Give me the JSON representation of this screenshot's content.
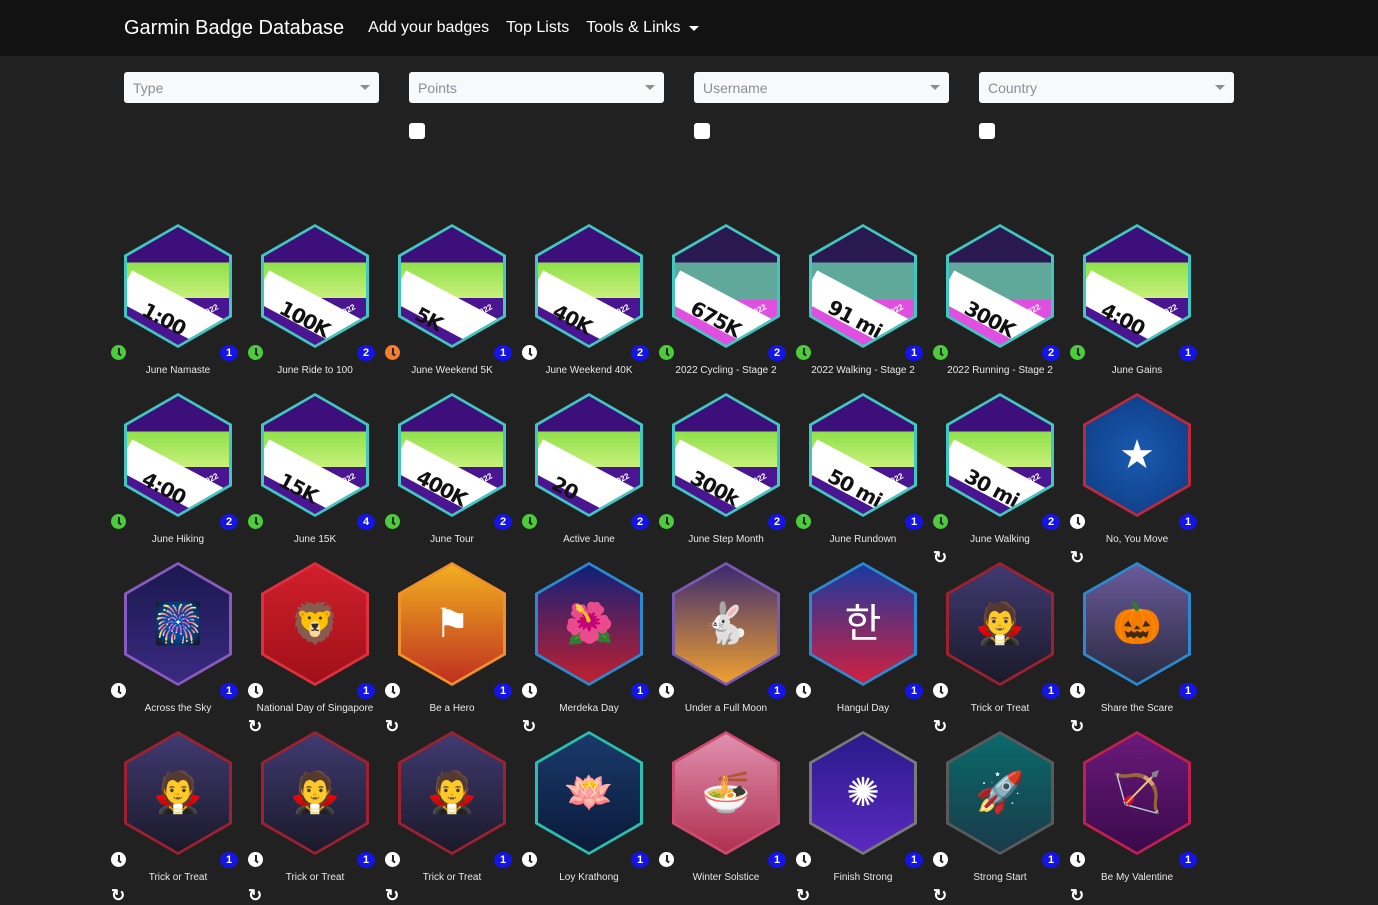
{
  "navbar": {
    "brand": "Garmin Badge Database",
    "links": [
      {
        "label": "Add your badges",
        "dropdown": false
      },
      {
        "label": "Top Lists",
        "dropdown": false
      },
      {
        "label": "Tools & Links",
        "dropdown": true
      }
    ]
  },
  "filters": [
    {
      "placeholder": "Type",
      "has_checkbox": false
    },
    {
      "placeholder": "Points",
      "has_checkbox": true,
      "checked": false
    },
    {
      "placeholder": "Username",
      "has_checkbox": true,
      "checked": false
    },
    {
      "placeholder": "Country",
      "has_checkbox": true,
      "checked": false
    }
  ],
  "colors": {
    "clock_green": "#4ccc3a",
    "clock_orange": "#f08030",
    "clock_white": "#ffffff",
    "count_badge": "#1414e6",
    "navbar_bg": "#121212",
    "page_bg": "#212121"
  },
  "badges": [
    {
      "name": "June Namaste",
      "label": "1:00",
      "year": "2022",
      "count": "1",
      "clock": "green",
      "repeat": false,
      "theme": "june"
    },
    {
      "name": "June Ride to 100",
      "label": "100K",
      "year": "2022",
      "count": "2",
      "clock": "green",
      "repeat": false,
      "theme": "june"
    },
    {
      "name": "June Weekend 5K",
      "label": "5K",
      "year": "2022",
      "count": "1",
      "clock": "orange",
      "repeat": false,
      "theme": "june"
    },
    {
      "name": "June Weekend 40K",
      "label": "40K",
      "year": "2022",
      "count": "2",
      "clock": "white",
      "repeat": false,
      "theme": "june"
    },
    {
      "name": "2022 Cycling - Stage 2",
      "label": "675K",
      "year": "2022",
      "count": "2",
      "clock": "green",
      "repeat": false,
      "theme": "stage"
    },
    {
      "name": "2022 Walking - Stage 2",
      "label": "91 mi",
      "year": "2022",
      "count": "1",
      "clock": "green",
      "repeat": false,
      "theme": "stage"
    },
    {
      "name": "2022 Running - Stage 2",
      "label": "300K",
      "year": "2022",
      "count": "2",
      "clock": "green",
      "repeat": false,
      "theme": "stage"
    },
    {
      "name": "June Gains",
      "label": "4:00",
      "year": "2022",
      "count": "1",
      "clock": "green",
      "repeat": false,
      "theme": "june"
    },
    {
      "name": "June Hiking",
      "label": "4:00",
      "year": "2022",
      "count": "2",
      "clock": "green",
      "repeat": false,
      "theme": "june"
    },
    {
      "name": "June 15K",
      "label": "15K",
      "year": "2022",
      "count": "4",
      "clock": "green",
      "repeat": false,
      "theme": "june"
    },
    {
      "name": "June Tour",
      "label": "400K",
      "year": "2022",
      "count": "2",
      "clock": "green",
      "repeat": false,
      "theme": "june"
    },
    {
      "name": "Active June",
      "label": "20",
      "year": "2022",
      "count": "2",
      "clock": "green",
      "repeat": false,
      "theme": "june"
    },
    {
      "name": "June Step Month",
      "label": "300k",
      "year": "2022",
      "count": "2",
      "clock": "green",
      "repeat": false,
      "theme": "june"
    },
    {
      "name": "June Rundown",
      "label": "50 mi",
      "year": "2022",
      "count": "1",
      "clock": "green",
      "repeat": false,
      "theme": "june"
    },
    {
      "name": "June Walking",
      "label": "30 mi",
      "year": "2022",
      "count": "2",
      "clock": "green",
      "repeat": true,
      "theme": "june"
    },
    {
      "name": "No, You Move",
      "label": "",
      "year": "",
      "count": "1",
      "clock": "white",
      "repeat": true,
      "theme": "shield"
    },
    {
      "name": "Across the Sky",
      "label": "",
      "year": "",
      "count": "1",
      "clock": "white",
      "repeat": false,
      "theme": "sky"
    },
    {
      "name": "National Day of Singapore",
      "label": "",
      "year": "",
      "count": "1",
      "clock": "white",
      "repeat": true,
      "theme": "singapore"
    },
    {
      "name": "Be a Hero",
      "label": "",
      "year": "",
      "count": "1",
      "clock": "white",
      "repeat": true,
      "theme": "hero"
    },
    {
      "name": "Merdeka Day",
      "label": "",
      "year": "",
      "count": "1",
      "clock": "white",
      "repeat": true,
      "theme": "merdeka"
    },
    {
      "name": "Under a Full Moon",
      "label": "",
      "year": "",
      "count": "1",
      "clock": "white",
      "repeat": false,
      "theme": "moon"
    },
    {
      "name": "Hangul Day",
      "label": "",
      "year": "",
      "count": "1",
      "clock": "white",
      "repeat": false,
      "theme": "hangul"
    },
    {
      "name": "Trick or Treat",
      "label": "",
      "year": "",
      "count": "1",
      "clock": "white",
      "repeat": true,
      "theme": "halloween"
    },
    {
      "name": "Share the Scare",
      "label": "",
      "year": "",
      "count": "1",
      "clock": "white",
      "repeat": true,
      "theme": "pumpkin"
    },
    {
      "name": "Trick or Treat",
      "label": "",
      "year": "",
      "count": "1",
      "clock": "white",
      "repeat": true,
      "theme": "halloween"
    },
    {
      "name": "Trick or Treat",
      "label": "",
      "year": "",
      "count": "1",
      "clock": "white",
      "repeat": true,
      "theme": "halloween"
    },
    {
      "name": "Trick or Treat",
      "label": "",
      "year": "",
      "count": "1",
      "clock": "white",
      "repeat": true,
      "theme": "halloween"
    },
    {
      "name": "Loy Krathong",
      "label": "",
      "year": "",
      "count": "1",
      "clock": "white",
      "repeat": false,
      "theme": "krathong"
    },
    {
      "name": "Winter Solstice",
      "label": "",
      "year": "",
      "count": "1",
      "clock": "white",
      "repeat": false,
      "theme": "solstice"
    },
    {
      "name": "Finish Strong",
      "label": "",
      "year": "",
      "count": "1",
      "clock": "white",
      "repeat": true,
      "theme": "fireworks"
    },
    {
      "name": "Strong Start",
      "label": "",
      "year": "",
      "count": "1",
      "clock": "white",
      "repeat": true,
      "theme": "rocket"
    },
    {
      "name": "Be My Valentine",
      "label": "",
      "year": "",
      "count": "1",
      "clock": "white",
      "repeat": true,
      "theme": "valentine"
    }
  ]
}
